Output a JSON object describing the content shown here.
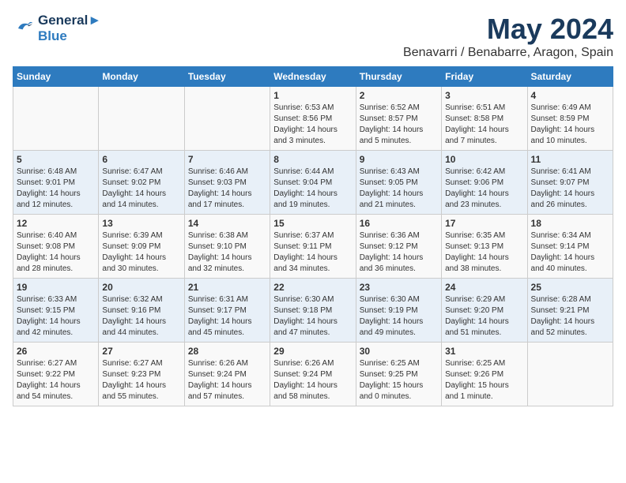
{
  "header": {
    "logo_line1": "General",
    "logo_line2": "Blue",
    "title": "May 2024",
    "subtitle": "Benavarri / Benabarre, Aragon, Spain"
  },
  "days_of_week": [
    "Sunday",
    "Monday",
    "Tuesday",
    "Wednesday",
    "Thursday",
    "Friday",
    "Saturday"
  ],
  "weeks": [
    [
      {
        "day": "",
        "info": ""
      },
      {
        "day": "",
        "info": ""
      },
      {
        "day": "",
        "info": ""
      },
      {
        "day": "1",
        "info": "Sunrise: 6:53 AM\nSunset: 8:56 PM\nDaylight: 14 hours and 3 minutes."
      },
      {
        "day": "2",
        "info": "Sunrise: 6:52 AM\nSunset: 8:57 PM\nDaylight: 14 hours and 5 minutes."
      },
      {
        "day": "3",
        "info": "Sunrise: 6:51 AM\nSunset: 8:58 PM\nDaylight: 14 hours and 7 minutes."
      },
      {
        "day": "4",
        "info": "Sunrise: 6:49 AM\nSunset: 8:59 PM\nDaylight: 14 hours and 10 minutes."
      }
    ],
    [
      {
        "day": "5",
        "info": "Sunrise: 6:48 AM\nSunset: 9:01 PM\nDaylight: 14 hours and 12 minutes."
      },
      {
        "day": "6",
        "info": "Sunrise: 6:47 AM\nSunset: 9:02 PM\nDaylight: 14 hours and 14 minutes."
      },
      {
        "day": "7",
        "info": "Sunrise: 6:46 AM\nSunset: 9:03 PM\nDaylight: 14 hours and 17 minutes."
      },
      {
        "day": "8",
        "info": "Sunrise: 6:44 AM\nSunset: 9:04 PM\nDaylight: 14 hours and 19 minutes."
      },
      {
        "day": "9",
        "info": "Sunrise: 6:43 AM\nSunset: 9:05 PM\nDaylight: 14 hours and 21 minutes."
      },
      {
        "day": "10",
        "info": "Sunrise: 6:42 AM\nSunset: 9:06 PM\nDaylight: 14 hours and 23 minutes."
      },
      {
        "day": "11",
        "info": "Sunrise: 6:41 AM\nSunset: 9:07 PM\nDaylight: 14 hours and 26 minutes."
      }
    ],
    [
      {
        "day": "12",
        "info": "Sunrise: 6:40 AM\nSunset: 9:08 PM\nDaylight: 14 hours and 28 minutes."
      },
      {
        "day": "13",
        "info": "Sunrise: 6:39 AM\nSunset: 9:09 PM\nDaylight: 14 hours and 30 minutes."
      },
      {
        "day": "14",
        "info": "Sunrise: 6:38 AM\nSunset: 9:10 PM\nDaylight: 14 hours and 32 minutes."
      },
      {
        "day": "15",
        "info": "Sunrise: 6:37 AM\nSunset: 9:11 PM\nDaylight: 14 hours and 34 minutes."
      },
      {
        "day": "16",
        "info": "Sunrise: 6:36 AM\nSunset: 9:12 PM\nDaylight: 14 hours and 36 minutes."
      },
      {
        "day": "17",
        "info": "Sunrise: 6:35 AM\nSunset: 9:13 PM\nDaylight: 14 hours and 38 minutes."
      },
      {
        "day": "18",
        "info": "Sunrise: 6:34 AM\nSunset: 9:14 PM\nDaylight: 14 hours and 40 minutes."
      }
    ],
    [
      {
        "day": "19",
        "info": "Sunrise: 6:33 AM\nSunset: 9:15 PM\nDaylight: 14 hours and 42 minutes."
      },
      {
        "day": "20",
        "info": "Sunrise: 6:32 AM\nSunset: 9:16 PM\nDaylight: 14 hours and 44 minutes."
      },
      {
        "day": "21",
        "info": "Sunrise: 6:31 AM\nSunset: 9:17 PM\nDaylight: 14 hours and 45 minutes."
      },
      {
        "day": "22",
        "info": "Sunrise: 6:30 AM\nSunset: 9:18 PM\nDaylight: 14 hours and 47 minutes."
      },
      {
        "day": "23",
        "info": "Sunrise: 6:30 AM\nSunset: 9:19 PM\nDaylight: 14 hours and 49 minutes."
      },
      {
        "day": "24",
        "info": "Sunrise: 6:29 AM\nSunset: 9:20 PM\nDaylight: 14 hours and 51 minutes."
      },
      {
        "day": "25",
        "info": "Sunrise: 6:28 AM\nSunset: 9:21 PM\nDaylight: 14 hours and 52 minutes."
      }
    ],
    [
      {
        "day": "26",
        "info": "Sunrise: 6:27 AM\nSunset: 9:22 PM\nDaylight: 14 hours and 54 minutes."
      },
      {
        "day": "27",
        "info": "Sunrise: 6:27 AM\nSunset: 9:23 PM\nDaylight: 14 hours and 55 minutes."
      },
      {
        "day": "28",
        "info": "Sunrise: 6:26 AM\nSunset: 9:24 PM\nDaylight: 14 hours and 57 minutes."
      },
      {
        "day": "29",
        "info": "Sunrise: 6:26 AM\nSunset: 9:24 PM\nDaylight: 14 hours and 58 minutes."
      },
      {
        "day": "30",
        "info": "Sunrise: 6:25 AM\nSunset: 9:25 PM\nDaylight: 15 hours and 0 minutes."
      },
      {
        "day": "31",
        "info": "Sunrise: 6:25 AM\nSunset: 9:26 PM\nDaylight: 15 hours and 1 minute."
      },
      {
        "day": "",
        "info": ""
      }
    ]
  ]
}
